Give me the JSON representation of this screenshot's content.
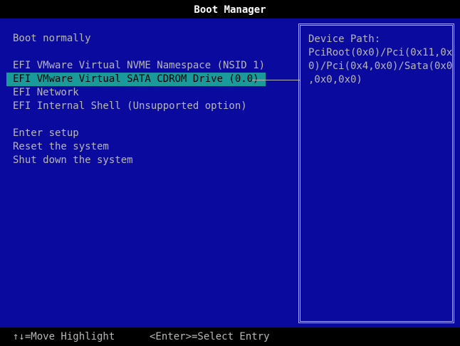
{
  "title": "Boot Manager",
  "menu": {
    "items": [
      {
        "label": "Boot normally",
        "selected": false
      },
      {
        "label": "EFI VMware Virtual NVME Namespace (NSID 1)",
        "selected": false
      },
      {
        "label": "EFI VMware Virtual SATA CDROM Drive (0.0)",
        "selected": true
      },
      {
        "label": "EFI Network",
        "selected": false
      },
      {
        "label": "EFI Internal Shell (Unsupported option)",
        "selected": false
      },
      {
        "label": "Enter setup",
        "selected": false
      },
      {
        "label": "Reset the system",
        "selected": false
      },
      {
        "label": "Shut down the system",
        "selected": false
      }
    ]
  },
  "help_panel": {
    "title": "Device Path:",
    "lines": [
      "PciRoot(0x0)/Pci(0x11,0x",
      "0)/Pci(0x4,0x0)/Sata(0x0",
      ",0x0,0x0)"
    ]
  },
  "footer": {
    "move_hint": "↑↓=Move Highlight",
    "select_hint": "<Enter>=Select Entry"
  },
  "colors": {
    "background": "#0a0a9f",
    "highlight": "#1a9a9a",
    "text": "#b8b8b8",
    "title_text": "#ffffff"
  }
}
